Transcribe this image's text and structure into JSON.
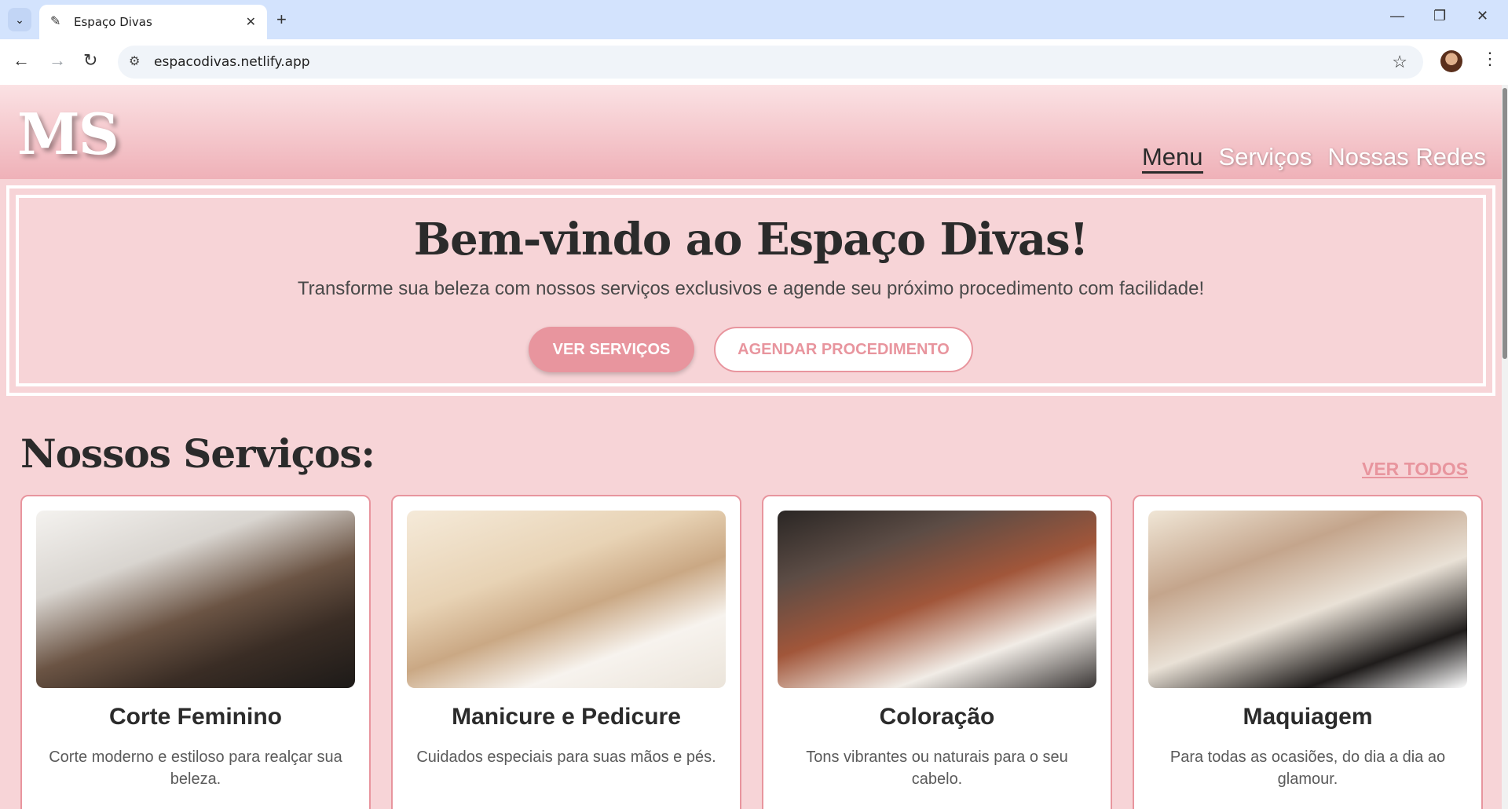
{
  "browser": {
    "tab_title": "Espaço Divas",
    "url": "espacodivas.netlify.app"
  },
  "header": {
    "logo": "MS",
    "nav": [
      {
        "label": "Menu"
      },
      {
        "label": "Serviços"
      },
      {
        "label": "Nossas Redes"
      }
    ]
  },
  "hero": {
    "title": "Bem-vindo ao Espaço Divas!",
    "subtitle": "Transforme sua beleza com nossos serviços exclusivos e agende seu próximo procedimento com facilidade!",
    "primary_button": "VER SERVIÇOS",
    "secondary_button": "AGENDAR PROCEDIMENTO"
  },
  "services": {
    "title": "Nossos Serviços:",
    "see_all": "VER TODOS",
    "cards": [
      {
        "title": "Corte Feminino",
        "desc": "Corte moderno e estiloso para realçar sua beleza."
      },
      {
        "title": "Manicure e Pedicure",
        "desc": "Cuidados especiais para suas mãos e pés."
      },
      {
        "title": "Coloração",
        "desc": "Tons vibrantes ou naturais para o seu cabelo."
      },
      {
        "title": "Maquiagem",
        "desc": "Para todas as ocasiões, do dia a dia ao glamour."
      }
    ]
  },
  "colors": {
    "accent": "#e8959e",
    "background": "#f7d4d7"
  }
}
